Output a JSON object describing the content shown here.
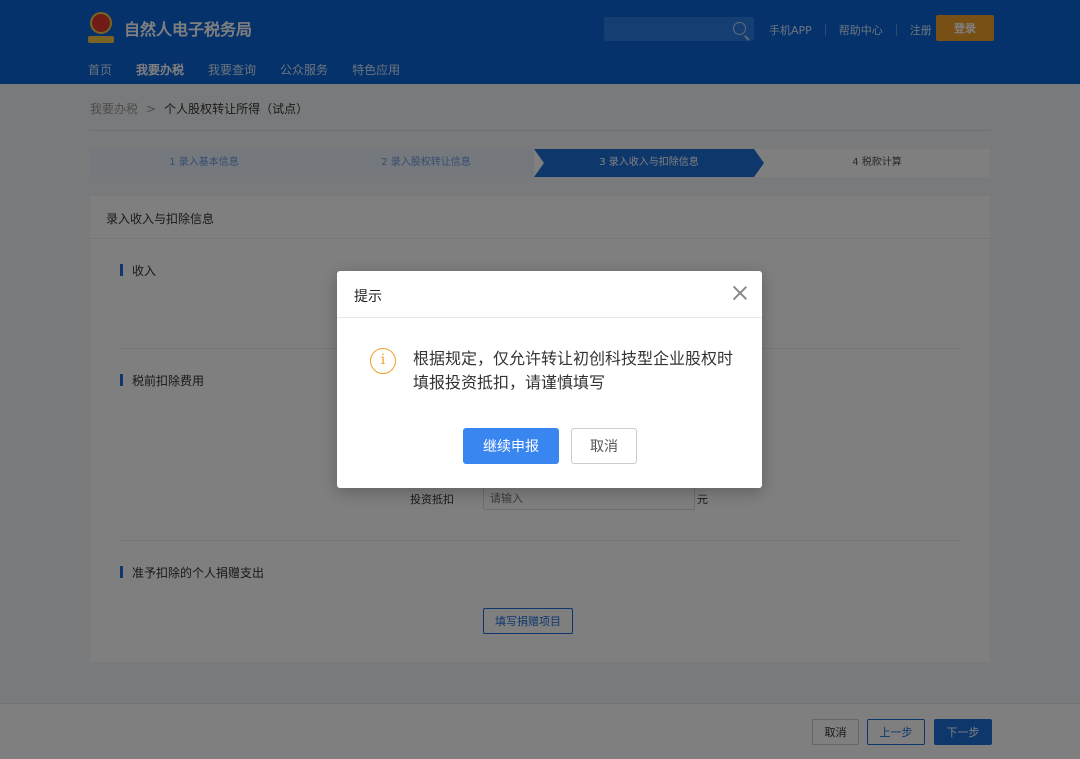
{
  "header": {
    "site_name": "自然人电子税务局",
    "search_placeholder": "",
    "links": [
      "手机APP",
      "帮助中心",
      "注册"
    ],
    "login_label": "登录",
    "nav": [
      "首页",
      "我要办税",
      "我要查询",
      "公众服务",
      "特色应用"
    ],
    "active_nav": "我要办税"
  },
  "breadcrumb": {
    "parent": "我要办税",
    "separator": ">",
    "current": "个人股权转让所得（试点）"
  },
  "steps": [
    "1  录入基本信息",
    "2  录入股权转让信息",
    "3  录入收入与扣除信息",
    "4  税款计算"
  ],
  "card": {
    "title": "录入收入与扣除信息",
    "sections": [
      "收入",
      "税前扣除费用",
      "准予扣除的个人捐赠支出"
    ],
    "field_label": "投资抵扣",
    "field_placeholder": "请输入",
    "field_unit": "元",
    "donate_button": "填写捐赠项目"
  },
  "footer": {
    "cancel": "取消",
    "prev": "上一步",
    "next": "下一步"
  },
  "modal": {
    "title": "提示",
    "message": "根据规定，仅允许转让初创科技型企业股权时填报投资抵扣，请谨慎填写",
    "info_glyph": "i",
    "confirm": "继续申报",
    "cancel": "取消"
  },
  "colors": {
    "header_bg": "#0b64d6",
    "primary": "#1d6fd8",
    "modal_primary": "#3a86f0",
    "warning": "#f0a12a"
  }
}
